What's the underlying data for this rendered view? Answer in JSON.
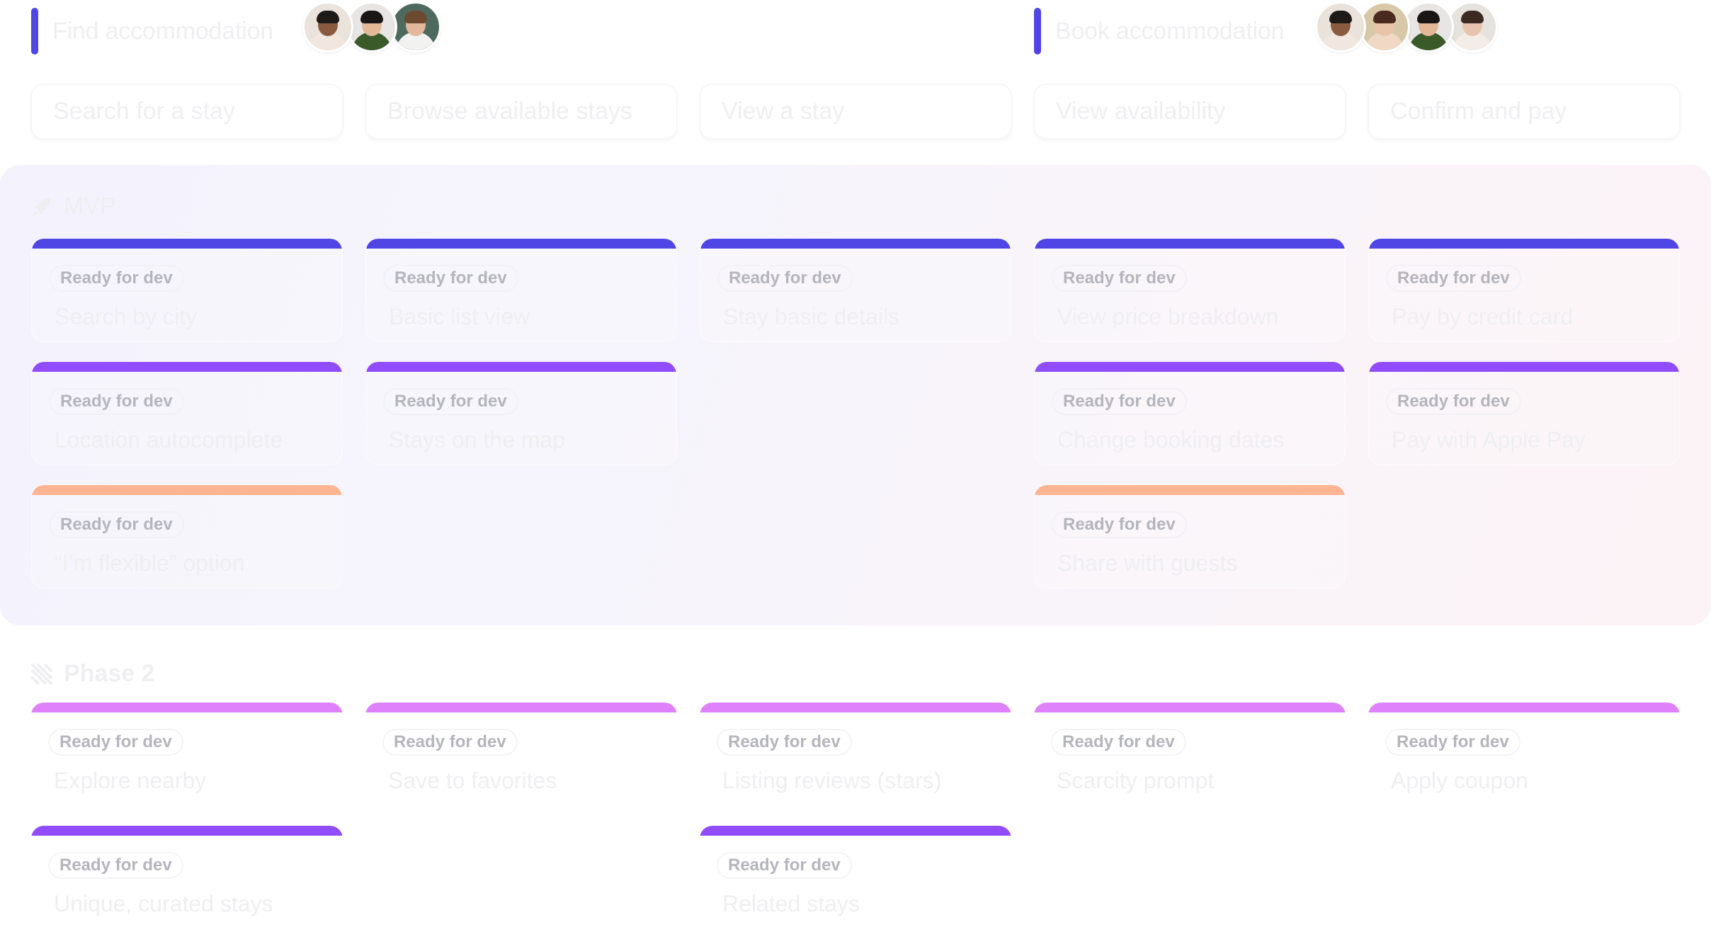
{
  "activities": [
    {
      "title": "Find accommodation",
      "accent_color": "#5046e5",
      "avatars": [
        {
          "name": "avatar-man-glasses-beard",
          "skin": "#8a5a40",
          "hair": "#1d1a18",
          "shirt": "#f1e6e0",
          "bg": "#e9e3dc"
        },
        {
          "name": "avatar-woman-glasses",
          "skin": "#e2b897",
          "hair": "#1a1614",
          "shirt": "#3a5a2a",
          "bg": "#e8e6e4"
        },
        {
          "name": "avatar-young-man",
          "skin": "#e3b89a",
          "hair": "#6b4a30",
          "shirt": "#f2f2f0",
          "bg": "#4e6a5e"
        }
      ]
    },
    {
      "title": "Book accommodation",
      "accent_color": "#5046e5",
      "avatars": [
        {
          "name": "avatar-man-glasses-beard",
          "skin": "#8a5a40",
          "hair": "#1d1a18",
          "shirt": "#f1e6e0",
          "bg": "#e9e3dc"
        },
        {
          "name": "avatar-woman-bun",
          "skin": "#e9c4a8",
          "hair": "#4a2a1e",
          "shirt": "#f0d8c4",
          "bg": "#d9c8a8"
        },
        {
          "name": "avatar-woman-glasses",
          "skin": "#e2b897",
          "hair": "#1a1614",
          "shirt": "#3a5a2a",
          "bg": "#e8e6e4"
        },
        {
          "name": "avatar-woman-red-flower",
          "skin": "#e8c4ae",
          "hair": "#3a2a22",
          "shirt": "#f4ece6",
          "bg": "#e6e2de"
        }
      ]
    }
  ],
  "steps": [
    "Search for a stay",
    "Browse available stays",
    "View a stay",
    "View availability",
    "Confirm and pay"
  ],
  "status_colors": {
    "indigo": "#5046e5",
    "violet": "#914cfb",
    "peach": "#ffb492",
    "orchid": "#de81fa"
  },
  "releases": [
    {
      "name": "MVP",
      "icon": "rocket-icon",
      "columns": [
        [
          {
            "status": "Ready for dev",
            "title": "Search by city",
            "color": "indigo"
          },
          {
            "status": "Ready for dev",
            "title": "Location autocomplete",
            "color": "violet"
          },
          {
            "status": "Ready for dev",
            "title": "“I’m flexible” option",
            "color": "peach"
          }
        ],
        [
          {
            "status": "Ready for dev",
            "title": "Basic list view",
            "color": "indigo"
          },
          {
            "status": "Ready for dev",
            "title": "Stays on the map",
            "color": "violet"
          }
        ],
        [
          {
            "status": "Ready for dev",
            "title": "Stay basic details",
            "color": "indigo"
          }
        ],
        [
          {
            "status": "Ready for dev",
            "title": "View price breakdown",
            "color": "indigo"
          },
          {
            "status": "Ready for dev",
            "title": "Change booking dates",
            "color": "violet"
          },
          {
            "status": "Ready for dev",
            "title": "Share with guests",
            "color": "peach"
          }
        ],
        [
          {
            "status": "Ready for dev",
            "title": "Pay by credit card",
            "color": "indigo"
          },
          {
            "status": "Ready for dev",
            "title": "Pay with Apple Pay",
            "color": "violet"
          }
        ]
      ]
    },
    {
      "name": "Phase 2",
      "icon": "diagonal-lines-icon",
      "columns": [
        [
          {
            "status": "Ready for dev",
            "title": "Explore nearby",
            "color": "orchid"
          },
          {
            "status": "Ready for dev",
            "title": "Unique, curated stays",
            "color": "violet"
          }
        ],
        [
          {
            "status": "Ready for dev",
            "title": "Save to favorites",
            "color": "orchid"
          }
        ],
        [
          {
            "status": "Ready for dev",
            "title": "Listing reviews (stars)",
            "color": "orchid"
          },
          {
            "status": "Ready for dev",
            "title": "Related stays",
            "color": "violet"
          }
        ],
        [
          {
            "status": "Ready for dev",
            "title": "Scarcity prompt",
            "color": "orchid"
          }
        ],
        [
          {
            "status": "Ready for dev",
            "title": "Apply coupon",
            "color": "orchid"
          }
        ]
      ]
    }
  ]
}
